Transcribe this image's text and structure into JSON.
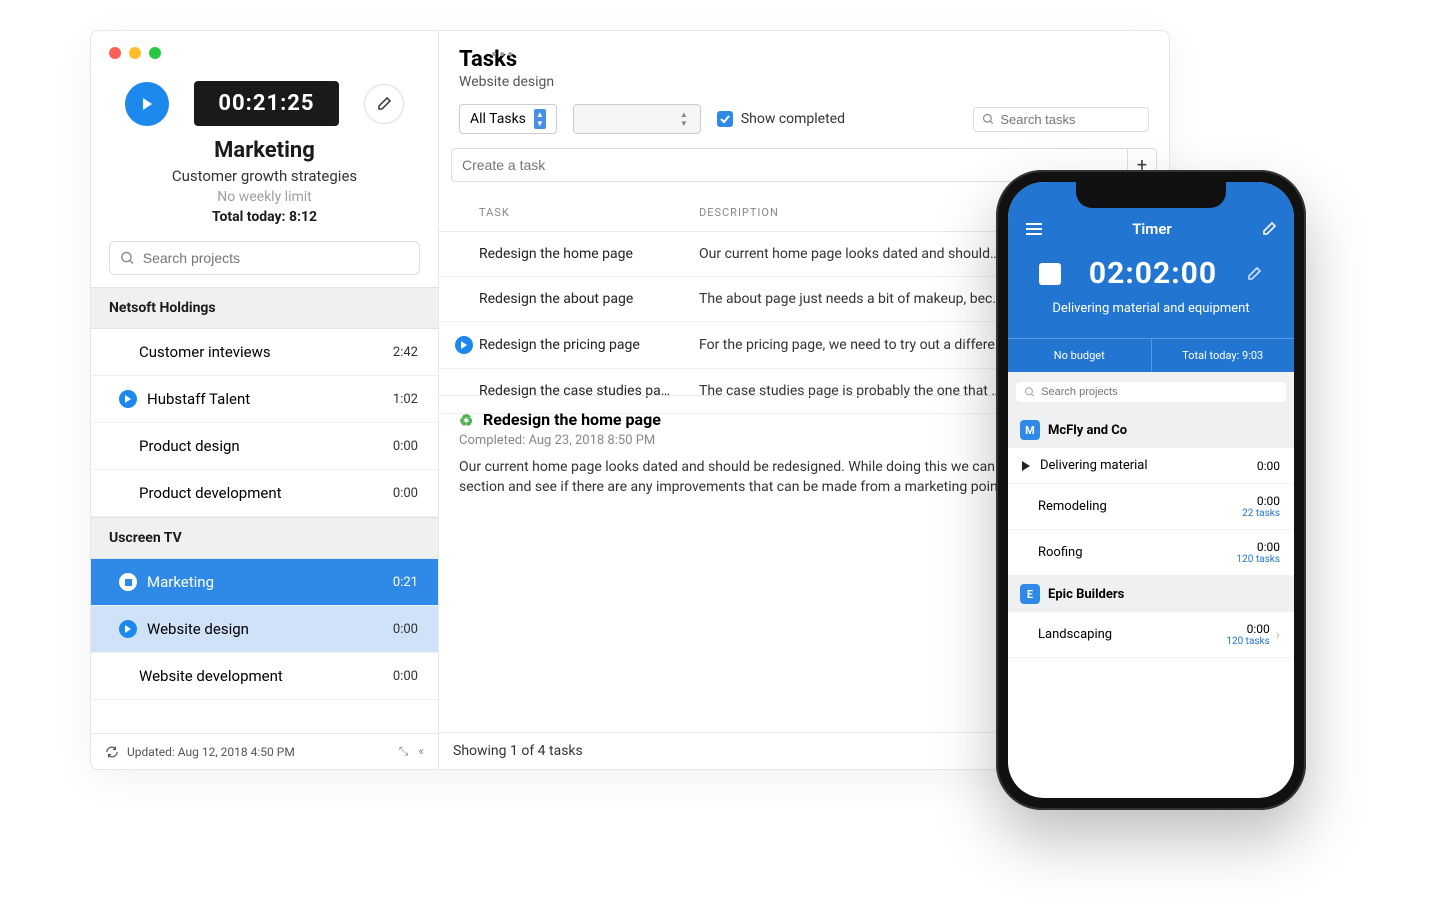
{
  "sidebar": {
    "timer": "00:21:25",
    "project": "Marketing",
    "subtitle": "Customer growth strategies",
    "limit": "No weekly limit",
    "total": "Total today: 8:12",
    "search_placeholder": "Search projects",
    "groups": [
      {
        "name": "Netsoft Holdings",
        "items": [
          {
            "name": "Customer inteviews",
            "time": "2:42",
            "state": "none"
          },
          {
            "name": "Hubstaff Talent",
            "time": "1:02",
            "state": "play"
          },
          {
            "name": "Product design",
            "time": "0:00",
            "state": "none"
          },
          {
            "name": "Product development",
            "time": "0:00",
            "state": "none"
          }
        ]
      },
      {
        "name": "Uscreen TV",
        "items": [
          {
            "name": "Marketing",
            "time": "0:21",
            "state": "active"
          },
          {
            "name": "Website design",
            "time": "0:00",
            "state": "selplay"
          },
          {
            "name": "Website development",
            "time": "0:00",
            "state": "none"
          }
        ]
      }
    ],
    "updated": "Updated: Aug 12, 2018 4:50 PM"
  },
  "main": {
    "title": "Tasks",
    "crumb": "Website design",
    "all_tasks": "All Tasks",
    "show_completed": "Show completed",
    "search_tasks_placeholder": "Search tasks",
    "create_placeholder": "Create a task",
    "headers": {
      "task": "TASK",
      "desc": "DESCRIPTION"
    },
    "rows": [
      {
        "task": "Redesign the home page",
        "desc": "Our current home page looks dated and should…",
        "play": false
      },
      {
        "task": "Redesign the about page",
        "desc": "The about page just needs a bit of makeup, bec…",
        "play": false
      },
      {
        "task": "Redesign the pricing page",
        "desc": "For the pricing page, we need to try out a differe…",
        "play": true
      },
      {
        "task": "Redesign the case studies pa…",
        "desc": "The case studies page is probably the one that …",
        "play": false
      }
    ],
    "detail": {
      "title": "Redesign the home page",
      "meta": "Completed: Aug 23, 2018 8:50 PM",
      "body": "Our current home page looks dated and should be redesigned. While doing this we can also take a look at each section and see if there are any improvements that can be made from a marketing point of view."
    },
    "status": "Showing 1 of 4 tasks"
  },
  "phone": {
    "title": "Timer",
    "readout": "02:02:00",
    "subtitle": "Delivering material and equipment",
    "no_budget": "No budget",
    "total": "Total today: 9:03",
    "search_placeholder": "Search projects",
    "groups": [
      {
        "badge": "M",
        "color": "#2f8ae7",
        "name": "McFly and Co",
        "items": [
          {
            "name": "Delivering material",
            "time": "0:00",
            "sub": "",
            "play": true
          },
          {
            "name": "Remodeling",
            "time": "0:00",
            "sub": "22 tasks",
            "play": false
          },
          {
            "name": "Roofing",
            "time": "0:00",
            "sub": "120 tasks",
            "play": false
          }
        ]
      },
      {
        "badge": "E",
        "color": "#2f8ae7",
        "name": "Epic Builders",
        "items": [
          {
            "name": "Landscaping",
            "time": "0:00",
            "sub": "120 tasks",
            "play": false,
            "chev": true
          }
        ]
      }
    ]
  }
}
